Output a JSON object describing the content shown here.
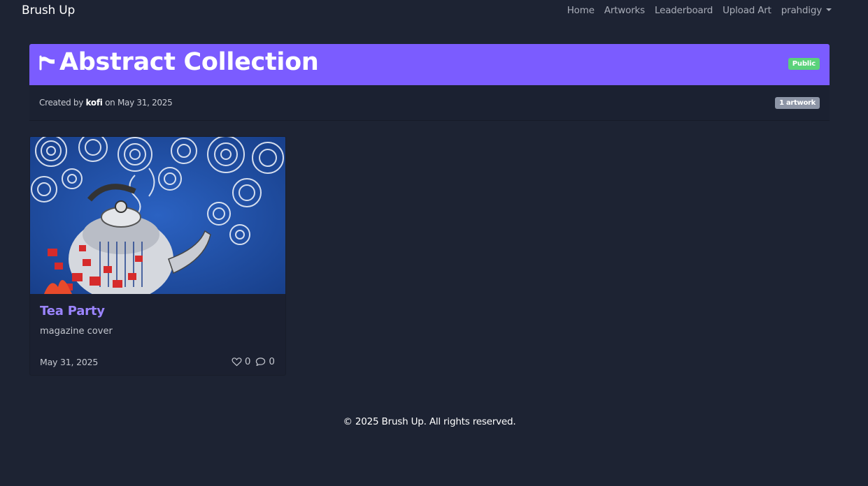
{
  "nav": {
    "brand": "Brush Up",
    "links": [
      "Home",
      "Artworks",
      "Leaderboard",
      "Upload Art"
    ],
    "user": "prahdigy"
  },
  "collection": {
    "icon": "flag-icon",
    "title": "Abstract Collection",
    "visibility": "Public",
    "created_prefix": "Created by",
    "author": "kofi",
    "created_on": "on May 31, 2025",
    "count_badge": "1 artwork"
  },
  "artworks": [
    {
      "title": "Tea Party",
      "description": "magazine cover",
      "date": "May 31, 2025",
      "likes": "0",
      "comments": "0"
    }
  ],
  "footer": {
    "text": "© 2025 Brush Up. All rights reserved."
  },
  "colors": {
    "accent": "#7b5cff",
    "background": "#1d2333",
    "public_badge": "#5ad27a"
  }
}
